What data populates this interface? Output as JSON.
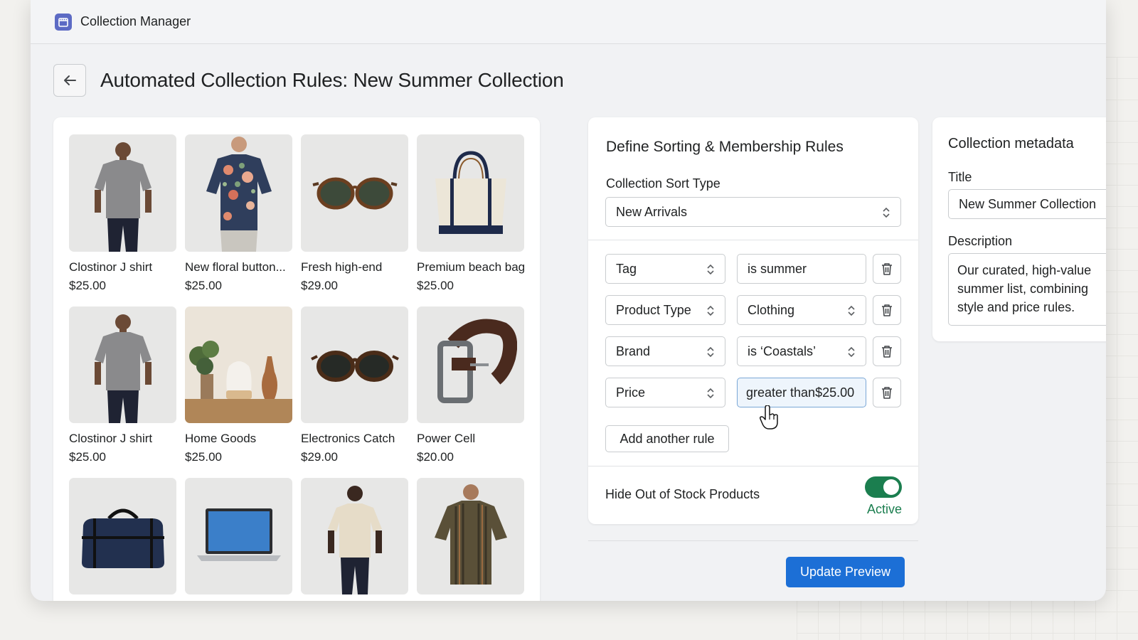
{
  "app": {
    "title": "Collection Manager"
  },
  "page": {
    "title": "Automated Collection Rules: New Summer Collection"
  },
  "products": [
    {
      "name": "Clostinor J shirt",
      "price": "$25.00",
      "image": "grey-tshirt"
    },
    {
      "name": "New floral button...",
      "price": "$25.00",
      "image": "floral-shirt"
    },
    {
      "name": "Fresh high-end",
      "price": "$29.00",
      "image": "tortoise-sunglasses"
    },
    {
      "name": "Premium beach bag",
      "price": "$25.00",
      "image": "canvas-tote"
    },
    {
      "name": "Clostinor J shirt",
      "price": "$25.00",
      "image": "grey-tshirt"
    },
    {
      "name": "Home Goods",
      "price": "$25.00",
      "image": "diffuser-vase"
    },
    {
      "name": "Electronics Catch",
      "price": "$29.00",
      "image": "dark-sunglasses"
    },
    {
      "name": "Power Cell",
      "price": "$20.00",
      "image": "leather-belt"
    },
    {
      "name": "",
      "price": "",
      "image": "duffel-bag"
    },
    {
      "name": "",
      "price": "",
      "image": "laptop"
    },
    {
      "name": "",
      "price": "",
      "image": "cream-tshirt"
    },
    {
      "name": "",
      "price": "",
      "image": "striped-shirt"
    }
  ],
  "rules": {
    "title": "Define Sorting & Membership Rules",
    "sort_label": "Collection Sort Type",
    "sort_value": "New Arrivals",
    "items": [
      {
        "field": "Tag",
        "value": "is summer",
        "value_is_select": false
      },
      {
        "field": "Product Type",
        "value": "Clothing",
        "value_is_select": true
      },
      {
        "field": "Brand",
        "value": "is ‘Coastals’",
        "value_is_select": true
      },
      {
        "field": "Price",
        "value": "greater than$25.00",
        "value_is_select": false
      }
    ],
    "add_label": "Add another rule",
    "hide_label": "Hide Out of Stock Products",
    "toggle_state": "Active",
    "toggle_on": true
  },
  "actions": {
    "update_label": "Update Preview"
  },
  "metadata": {
    "title": "Collection metadata",
    "title_label": "Title",
    "title_value": "New Summer Collection",
    "description_label": "Description",
    "description_value": "Our curated, high-value summer list, combining style and price rules."
  },
  "colors": {
    "accent": "#1c6fd6",
    "toggle": "#1b7e4f",
    "app_icon": "#5c6ac4"
  }
}
